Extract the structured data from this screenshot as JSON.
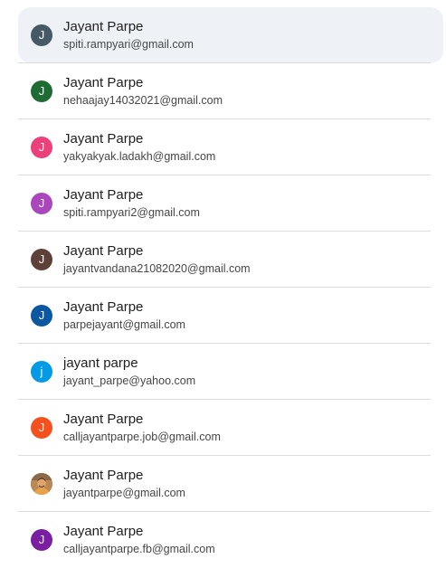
{
  "accounts": [
    {
      "name": "Jayant Parpe",
      "email": "spiti.rampyari@gmail.com",
      "initial": "J",
      "avatar_color": "#455a64",
      "selected": true
    },
    {
      "name": "Jayant Parpe",
      "email": "nehaajay14032021@gmail.com",
      "initial": "J",
      "avatar_color": "#1e6b34"
    },
    {
      "name": "Jayant Parpe",
      "email": "yakyakyak.ladakh@gmail.com",
      "initial": "J",
      "avatar_color": "#ec407a"
    },
    {
      "name": "Jayant Parpe",
      "email": "spiti.rampyari2@gmail.com",
      "initial": "J",
      "avatar_color": "#ab47bc"
    },
    {
      "name": "Jayant Parpe",
      "email": "jayantvandana21082020@gmail.com",
      "initial": "J",
      "avatar_color": "#5d4037"
    },
    {
      "name": "Jayant Parpe",
      "email": "parpejayant@gmail.com",
      "initial": "J",
      "avatar_color": "#0b57a0"
    },
    {
      "name": "jayant parpe",
      "email": "jayant_parpe@yahoo.com",
      "initial": "j",
      "avatar_color": "#039be5"
    },
    {
      "name": "Jayant Parpe",
      "email": "calljayantparpe.job@gmail.com",
      "initial": "J",
      "avatar_color": "#f4511e"
    },
    {
      "name": "Jayant Parpe",
      "email": "jayantparpe@gmail.com",
      "initial": "",
      "avatar_color": "#c58a4a",
      "avatar_icon": "profile-photo"
    },
    {
      "name": "Jayant Parpe",
      "email": "calljayantparpe.fb@gmail.com",
      "initial": "J",
      "avatar_color": "#7b1fa2"
    }
  ]
}
